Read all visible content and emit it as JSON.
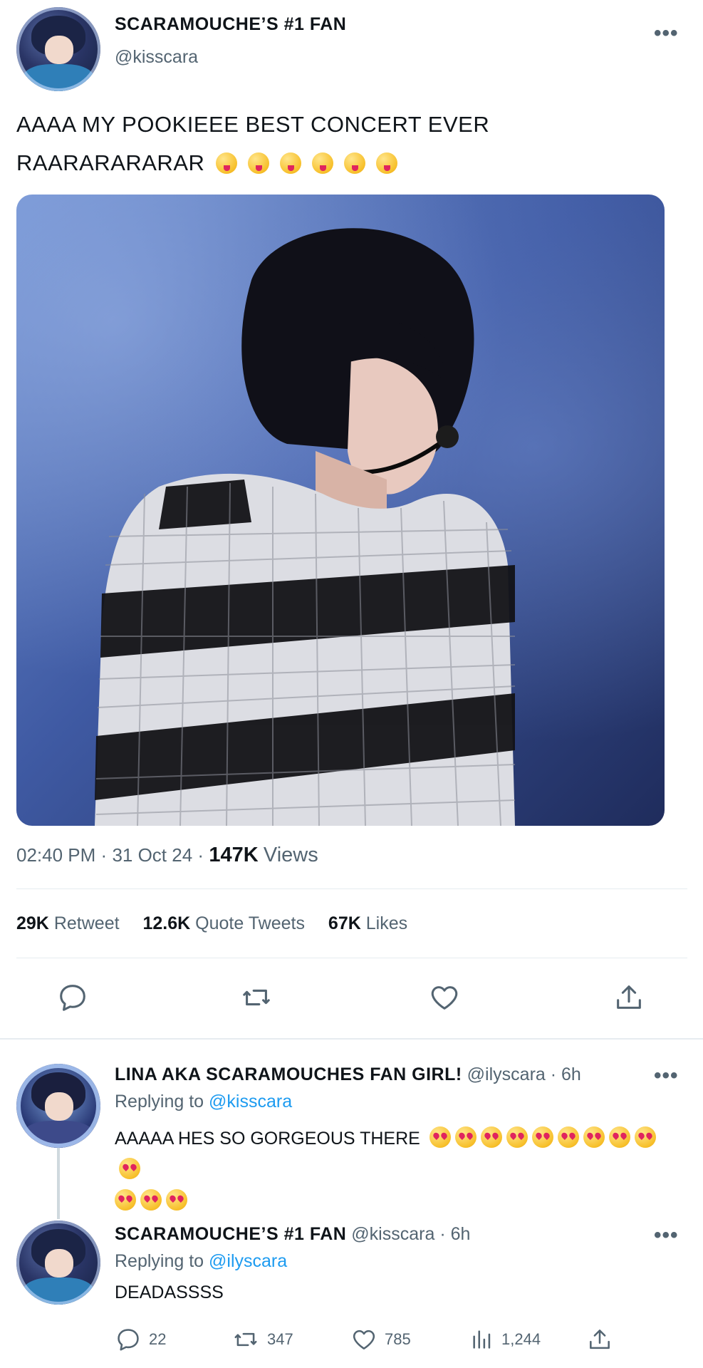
{
  "tweet": {
    "author_name": "SCARAMOUCHE’S #1 FAN",
    "author_handle": "@kisscara",
    "text_line1": "AAAA MY POOKIEEE BEST CONCERT EVER",
    "text_line2": "RAARARARARAR",
    "time": "02:40 PM",
    "date": "31 Oct 24",
    "separator": "·",
    "views_count": "147K",
    "views_label": "Views",
    "stats": {
      "retweets_count": "29K",
      "retweets_label": "Retweet",
      "quotes_count": "12.6K",
      "quotes_label": "Quote Tweets",
      "likes_count": "67K",
      "likes_label": "Likes"
    }
  },
  "reply1": {
    "name": "LINA AKA SCARAMOUCHES FAN GIRL!",
    "handle": "@ilyscara",
    "age": "· 6h",
    "replying_label": "Replying to",
    "replying_to": "@kisscara",
    "text": "AAAAA HES SO GORGEOUS THERE"
  },
  "reply2": {
    "name": "SCARAMOUCHE’S #1 FAN",
    "handle": "@kisscara",
    "age": "· 6h",
    "replying_label": "Replying to",
    "replying_to": "@ilyscara",
    "text": "DEADASSSS",
    "actions": {
      "replies": "22",
      "retweets": "347",
      "likes": "785",
      "views": "1,244"
    }
  },
  "more_label": "•••",
  "colors": {
    "link": "#1d9bf0",
    "muted": "#536471",
    "divider": "#e6ecf0"
  }
}
